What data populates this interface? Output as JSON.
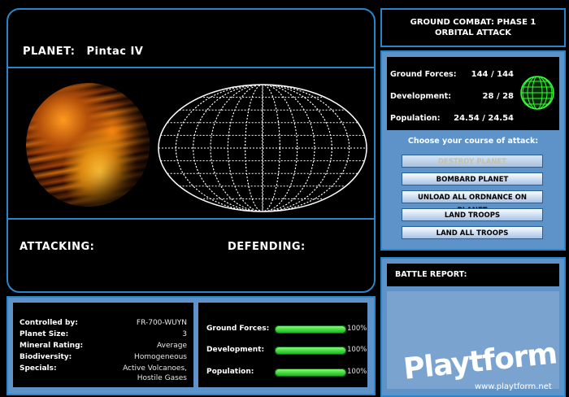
{
  "planet": {
    "label": "PLANET:",
    "name": "Pintac IV"
  },
  "main": {
    "attacking_label": "ATTACKING:",
    "defending_label": "DEFENDING:"
  },
  "phase": {
    "line1": "GROUND COMBAT: PHASE 1",
    "line2": "ORBITAL ATTACK"
  },
  "stats": [
    {
      "label": "Ground Forces:",
      "value": "144 / 144"
    },
    {
      "label": "Development:",
      "value": "28 / 28"
    },
    {
      "label": "Population:",
      "value": "24.54 / 24.54"
    }
  ],
  "attack": {
    "prompt": "Choose your course of attack:",
    "buttons": [
      {
        "label": "DESTROY PLANET",
        "enabled": false
      },
      {
        "label": "BOMBARD PLANET",
        "enabled": true
      },
      {
        "label": "UNLOAD ALL ORDNANCE ON PLANET",
        "enabled": true
      },
      {
        "label": "LAND TROOPS",
        "enabled": true
      },
      {
        "label": "LAND ALL TROOPS",
        "enabled": true
      }
    ]
  },
  "report": {
    "title": "BATTLE REPORT:"
  },
  "info": [
    {
      "label": "Controlled by:",
      "value": "FR-700-WUYN"
    },
    {
      "label": "Planet Size:",
      "value": "3"
    },
    {
      "label": "Mineral Rating:",
      "value": "Average"
    },
    {
      "label": "Biodiversity:",
      "value": "Homogeneous"
    },
    {
      "label": "Specials:",
      "value": "Active Volcanoes,",
      "value2": "Hostile Gases"
    }
  ],
  "bars": [
    {
      "label": "Ground Forces:",
      "percent_text": "100%",
      "level": 1.0
    },
    {
      "label": "Development:",
      "percent_text": "100%",
      "level": 1.0
    },
    {
      "label": "Population:",
      "percent_text": "100%",
      "level": 1.0
    }
  ],
  "watermark": {
    "brand": "Playtform",
    "url": "www.playtform.net"
  },
  "colors": {
    "frame": "#2a86c9",
    "panel_fill": "#5d93c8",
    "bar_green": "#2ad22a",
    "globe_green": "#33ff33"
  }
}
